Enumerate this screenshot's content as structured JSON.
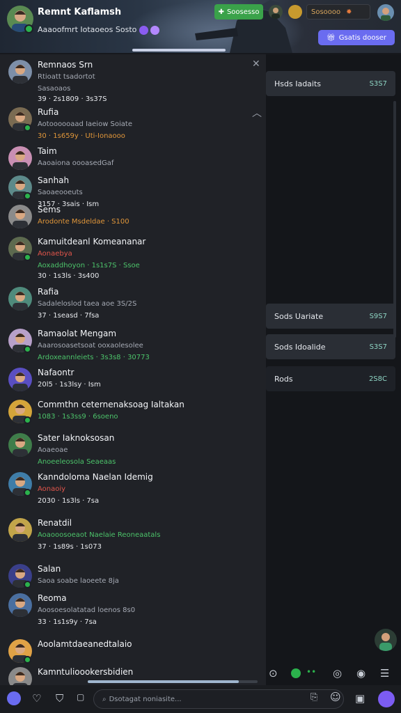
{
  "host": {
    "name": "Remnt Kaflamsh",
    "subtitle": "Aaaoofmrt Iotaoeos Sosto",
    "follow_label": "Soosesso",
    "viewer_text": "Sosoooo",
    "gift_label": "Gsatis dooser"
  },
  "chat": {
    "messages": [
      {
        "user": "Remnaos Srn",
        "line1": "Rtioatt tsadortot",
        "line1_color": "gray",
        "line2": "Sasaoaos",
        "line3": "39 · 2s1809 · 3s37S",
        "line3_color": "white"
      },
      {
        "user": "Rufia",
        "line1": "Aotoooooaad Iaeiow Soiate",
        "line1_color": "gray",
        "line2": "30 · 1s659y · Uti-Ionaooo",
        "line2_color": "orange"
      },
      {
        "user": "Taim",
        "line1": "Aaoaiona oooasedGaf",
        "line1_color": "gray"
      },
      {
        "user": "Sanhah",
        "line1": "Saoaeooeuts",
        "line1_color": "gray",
        "line2": "3157 · 3sais · Ism",
        "line2_color": "white"
      },
      {
        "user": "Sems",
        "line1": "Arodonte Msdeldae · S100",
        "line1_color": "orange"
      },
      {
        "user": "Kamuitdeanl Komeananar",
        "line1": "Aonaebya",
        "line1_color": "red",
        "line2": "Aoxaddhoyon · 1s1s7S · Ssoe",
        "line2_color": "green",
        "line3": "30 · 1s3ls · 3s400",
        "line3_color": "white"
      },
      {
        "user": "Rafia",
        "line1": "Sadaleloslod taea aoe 3S/2S",
        "line1_color": "gray",
        "line2": "37 · 1seasd · 7fsa",
        "line2_color": "white"
      },
      {
        "user": "Ramaolat Mengam",
        "line1": "Aaarosoasetsoat ooxaolesolee",
        "line1_color": "gray",
        "line2": "Ardoxeannleiets · 3s3s8 · 30773",
        "line2_color": "green"
      },
      {
        "user": "Nafaontr",
        "line1": "20l5 · 1s3lsy · Ism",
        "line1_color": "white"
      },
      {
        "user": "Commthn ceternenaksoag Ialtakan",
        "line1": "1083 · 1s3ss9 · 6soeno",
        "line1_color": "green"
      },
      {
        "user": "Sater Iaknoksosan",
        "line1": "Aoaeoae",
        "line1_color": "gray",
        "line2": "Anoeeleosola Seaeaas",
        "line2_color": "green"
      },
      {
        "user": "Kanndoloma Naelan Idemig",
        "line1": "Aonaoiy",
        "line1_color": "red",
        "line2": "2030 · 1s3ls · 7sa",
        "line2_color": "white"
      },
      {
        "user": "Renatdil",
        "line1": "Aoaooosoeaot Naelaie Reoneaatals",
        "line1_color": "green",
        "line2": "37 · 1s89s · 1s073",
        "line2_color": "white"
      },
      {
        "user": "Salan",
        "line1": "Saoa soabe laoeete 8ja",
        "line1_color": "gray"
      },
      {
        "user": "Reoma",
        "line1": "Aoosoesolatatad loenos 8s0",
        "line1_color": "gray",
        "line2": "33 · 1s1s9y · 7sa",
        "line2_color": "white"
      },
      {
        "user": "Aoolamtdaeanedtalaio",
        "line1": ""
      },
      {
        "user": "Kamntulioookersbidien",
        "line1": ""
      }
    ]
  },
  "right_panel": {
    "cards": [
      {
        "title": "Hsds Iadaits",
        "value": "S3S7"
      },
      {
        "title": "Sods Uariate",
        "value": "S9S7"
      },
      {
        "title": "Sods Idoalide",
        "value": "S3S7"
      },
      {
        "title": "Rods",
        "value": "2S8C"
      }
    ]
  },
  "bottom": {
    "input_placeholder": "Dsotagat noniasite..."
  },
  "chat_progress": 0.89,
  "colors": {
    "accent": "#6a6cf0",
    "follow": "#3aa24a",
    "chat_bg": "#202227"
  }
}
